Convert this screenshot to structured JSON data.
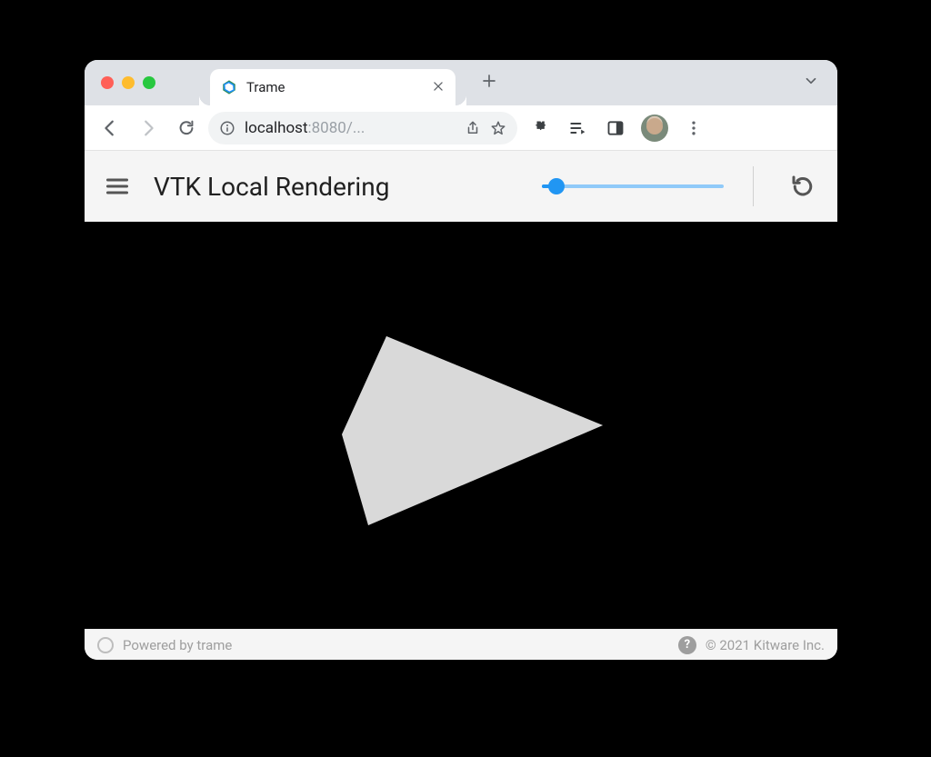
{
  "browser": {
    "tab": {
      "title": "Trame",
      "favicon": "trame-logo"
    },
    "url_display_host": "localhost",
    "url_display_port": ":8080/",
    "url_display_suffix": "...",
    "icons": {
      "back": "back-arrow-icon",
      "forward": "forward-arrow-icon",
      "reload": "reload-icon",
      "site_info": "info-icon",
      "share": "share-icon",
      "bookmark": "star-icon",
      "extensions": "puzzle-icon",
      "media": "media-control-icon",
      "side_panel": "side-panel-icon",
      "profile": "profile-avatar",
      "menu": "kebab-menu-icon",
      "new_tab": "plus-icon",
      "tab_overflow": "chevron-down-icon",
      "close_tab": "close-icon"
    }
  },
  "app": {
    "title": "VTK Local Rendering",
    "toolbar": {
      "menu_icon": "hamburger-icon",
      "reset_icon": "reset-camera-icon"
    },
    "slider": {
      "value_percent": 8
    },
    "footer": {
      "powered_by": "Powered by trame",
      "help_icon": "help-icon",
      "copyright": "© 2021 Kitware Inc."
    },
    "scene": {
      "object": "cone",
      "description": "Gray shaded 3D cone pointing right on black background"
    }
  }
}
